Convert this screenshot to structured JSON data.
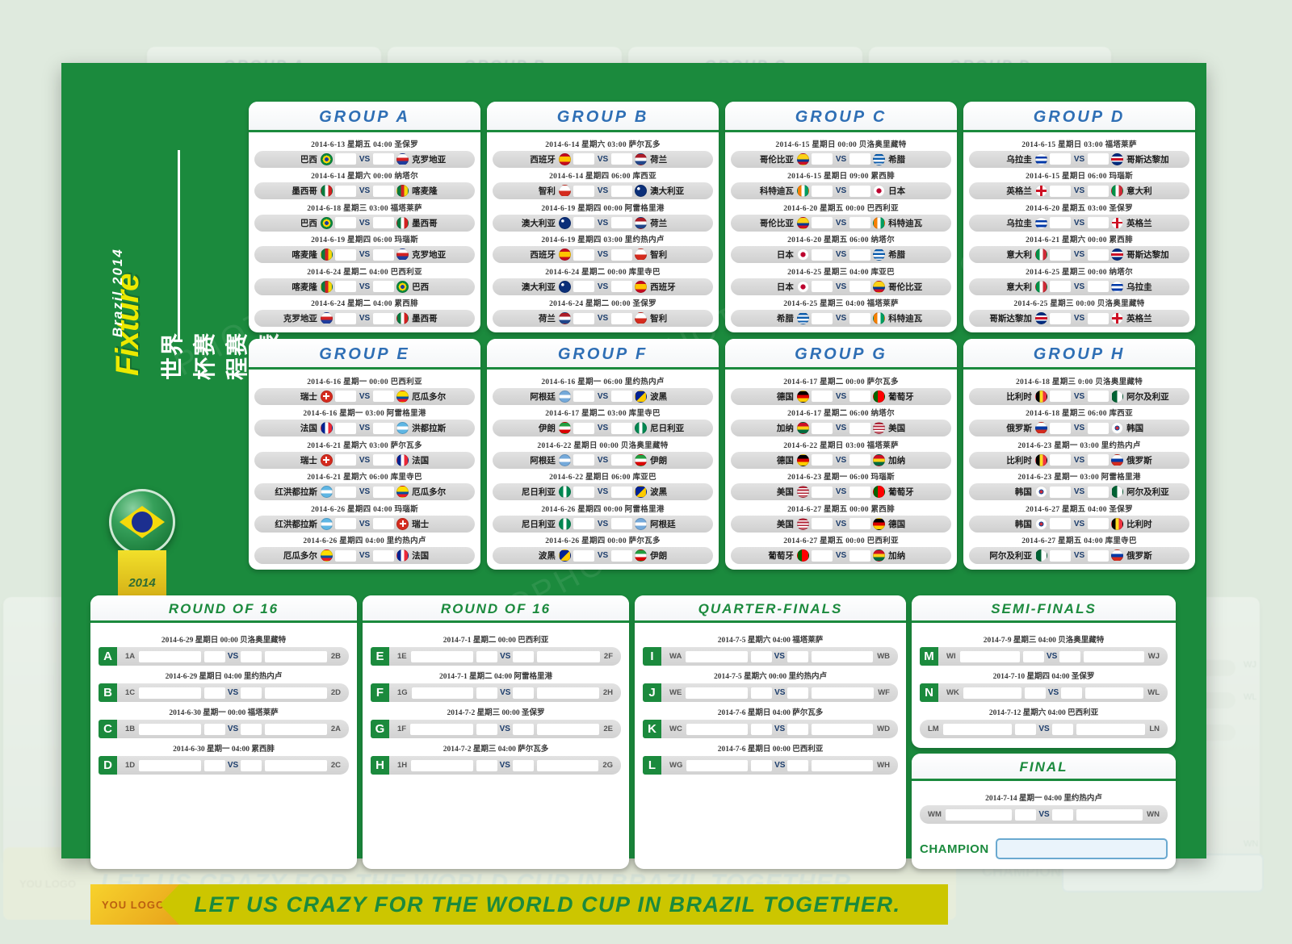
{
  "meta": {
    "title_main": "Fixture",
    "title_cn": "世界杯赛程赛果表",
    "title_sub": "Brazil 2014",
    "badge_year": "2014"
  },
  "banner": {
    "logo": "YOU LOGO",
    "text": "LET US CRAZY FOR THE WORLD CUP IN BRAZIL TOGETHER."
  },
  "vs_label": "VS",
  "groups": [
    {
      "name": "GROUP A",
      "matches": [
        {
          "date": "2014-6-13 星期五 04:00  圣保罗",
          "home": "巴西",
          "away": "克罗地亚",
          "home_flag": "br",
          "away_flag": "hr"
        },
        {
          "date": "2014-6-14 星期六 00:00  纳塔尔",
          "home": "墨西哥",
          "away": "喀麦隆",
          "home_flag": "mx",
          "away_flag": "cm"
        },
        {
          "date": "2014-6-18 星期三 03:00  福塔莱萨",
          "home": "巴西",
          "away": "墨西哥",
          "home_flag": "br",
          "away_flag": "mx"
        },
        {
          "date": "2014-6-19 星期四 06:00  玛瑙斯",
          "home": "喀麦隆",
          "away": "克罗地亚",
          "home_flag": "cm",
          "away_flag": "hr"
        },
        {
          "date": "2014-6-24 星期二 04:00  巴西利亚",
          "home": "喀麦隆",
          "away": "巴西",
          "home_flag": "cm",
          "away_flag": "br"
        },
        {
          "date": "2014-6-24 星期二 04:00  累西腓",
          "home": "克罗地亚",
          "away": "墨西哥",
          "home_flag": "hr",
          "away_flag": "mx"
        }
      ]
    },
    {
      "name": "GROUP B",
      "matches": [
        {
          "date": "2014-6-14 星期六 03:00  萨尔瓦多",
          "home": "西班牙",
          "away": "荷兰",
          "home_flag": "es",
          "away_flag": "nl"
        },
        {
          "date": "2014-6-14 星期四 06:00  库西亚",
          "home": "智利",
          "away": "澳大利亚",
          "home_flag": "cl",
          "away_flag": "au"
        },
        {
          "date": "2014-6-19 星期四 00:00  阿雷格里港",
          "home": "澳大利亚",
          "away": "荷兰",
          "home_flag": "au",
          "away_flag": "nl"
        },
        {
          "date": "2014-6-19 星期四 03:00  里约热内卢",
          "home": "西班牙",
          "away": "智利",
          "home_flag": "es",
          "away_flag": "cl"
        },
        {
          "date": "2014-6-24 星期二 00:00  库里寺巴",
          "home": "澳大利亚",
          "away": "西班牙",
          "home_flag": "au",
          "away_flag": "es"
        },
        {
          "date": "2014-6-24 星期二 00:00  圣保罗",
          "home": "荷兰",
          "away": "智利",
          "home_flag": "nl",
          "away_flag": "cl"
        }
      ]
    },
    {
      "name": "GROUP C",
      "matches": [
        {
          "date": "2014-6-15 星期日 00:00  贝洛奥里藏特",
          "home": "哥伦比亚",
          "away": "希腊",
          "home_flag": "co",
          "away_flag": "gr"
        },
        {
          "date": "2014-6-15 星期日 09:00  累西腓",
          "home": "科特迪瓦",
          "away": "日本",
          "home_flag": "ci",
          "away_flag": "jp"
        },
        {
          "date": "2014-6-20 星期五 00:00  巴西利亚",
          "home": "哥伦比亚",
          "away": "科特迪瓦",
          "home_flag": "co",
          "away_flag": "ci"
        },
        {
          "date": "2014-6-20 星期五 06:00  纳塔尔",
          "home": "日本",
          "away": "希腊",
          "home_flag": "jp",
          "away_flag": "gr"
        },
        {
          "date": "2014-6-25 星期三 04:00  库亚巴",
          "home": "日本",
          "away": "哥伦比亚",
          "home_flag": "jp",
          "away_flag": "co"
        },
        {
          "date": "2014-6-25 星期三 04:00  福塔莱萨",
          "home": "希腊",
          "away": "科特迪瓦",
          "home_flag": "gr",
          "away_flag": "ci"
        }
      ]
    },
    {
      "name": "GROUP D",
      "matches": [
        {
          "date": "2014-6-15 星期日 03:00  福塔莱萨",
          "home": "乌拉圭",
          "away": "哥斯达黎加",
          "home_flag": "uy",
          "away_flag": "cr"
        },
        {
          "date": "2014-6-15 星期日 06:00  玛瑙斯",
          "home": "英格兰",
          "away": "意大利",
          "home_flag": "en",
          "away_flag": "it"
        },
        {
          "date": "2014-6-20 星期五 03:00  圣保罗",
          "home": "乌拉圭",
          "away": "英格兰",
          "home_flag": "uy",
          "away_flag": "en"
        },
        {
          "date": "2014-6-21 星期六 00:00  累西腓",
          "home": "意大利",
          "away": "哥斯达黎加",
          "home_flag": "it",
          "away_flag": "cr"
        },
        {
          "date": "2014-6-25 星期三 00:00  纳塔尔",
          "home": "意大利",
          "away": "乌拉圭",
          "home_flag": "it",
          "away_flag": "uy"
        },
        {
          "date": "2014-6-25 星期三 00:00  贝洛奥里藏特",
          "home": "哥斯达黎加",
          "away": "英格兰",
          "home_flag": "cr",
          "away_flag": "en"
        }
      ]
    },
    {
      "name": "GROUP E",
      "matches": [
        {
          "date": "2014-6-16 星期一 00:00  巴西利亚",
          "home": "瑞士",
          "away": "厄瓜多尔",
          "home_flag": "ch",
          "away_flag": "ec"
        },
        {
          "date": "2014-6-16 星期一 03:00  阿雷格里港",
          "home": "法国",
          "away": "洪都拉斯",
          "home_flag": "fr",
          "away_flag": "hn"
        },
        {
          "date": "2014-6-21 星期六 03:00  萨尔瓦多",
          "home": "瑞士",
          "away": "法国",
          "home_flag": "ch",
          "away_flag": "fr"
        },
        {
          "date": "2014-6-21 星期六 06:00  库里寺巴",
          "home": "红洪都拉斯",
          "away": "厄瓜多尔",
          "home_flag": "hn",
          "away_flag": "ec"
        },
        {
          "date": "2014-6-26 星期四 04:00  玛瑙斯",
          "home": "红洪都拉斯",
          "away": "瑞士",
          "home_flag": "hn",
          "away_flag": "ch"
        },
        {
          "date": "2014-6-26 星期四 04:00  里约热内卢",
          "home": "厄瓜多尔",
          "away": "法国",
          "home_flag": "ec",
          "away_flag": "fr"
        }
      ]
    },
    {
      "name": "GROUP F",
      "matches": [
        {
          "date": "2014-6-16 星期一 06:00  里约热内卢",
          "home": "阿根廷",
          "away": "波黑",
          "home_flag": "ar",
          "away_flag": "ba"
        },
        {
          "date": "2014-6-17 星期二 03:00  库里寺巴",
          "home": "伊朗",
          "away": "尼日利亚",
          "home_flag": "ir",
          "away_flag": "ng"
        },
        {
          "date": "2014-6-22 星期日 00:00  贝洛奥里藏特",
          "home": "阿根廷",
          "away": "伊朗",
          "home_flag": "ar",
          "away_flag": "ir"
        },
        {
          "date": "2014-6-22 星期日 06:00  库亚巴",
          "home": "尼日利亚",
          "away": "波黑",
          "home_flag": "ng",
          "away_flag": "ba"
        },
        {
          "date": "2014-6-26 星期四 00:00  阿雷格里港",
          "home": "尼日利亚",
          "away": "阿根廷",
          "home_flag": "ng",
          "away_flag": "ar"
        },
        {
          "date": "2014-6-26 星期四 00:00  萨尔瓦多",
          "home": "波黑",
          "away": "伊朗",
          "home_flag": "ba",
          "away_flag": "ir"
        }
      ]
    },
    {
      "name": "GROUP G",
      "matches": [
        {
          "date": "2014-6-17 星期二 00:00  萨尔瓦多",
          "home": "德国",
          "away": "葡萄牙",
          "home_flag": "de",
          "away_flag": "pt"
        },
        {
          "date": "2014-6-17 星期二 06:00  纳塔尔",
          "home": "加纳",
          "away": "美国",
          "home_flag": "gh",
          "away_flag": "us"
        },
        {
          "date": "2014-6-22 星期日 03:00  福塔莱萨",
          "home": "德国",
          "away": "加纳",
          "home_flag": "de",
          "away_flag": "gh"
        },
        {
          "date": "2014-6-23 星期一 06:00  玛瑙斯",
          "home": "美国",
          "away": "葡萄牙",
          "home_flag": "us",
          "away_flag": "pt"
        },
        {
          "date": "2014-6-27 星期五 00:00  累西腓",
          "home": "美国",
          "away": "德国",
          "home_flag": "us",
          "away_flag": "de"
        },
        {
          "date": "2014-6-27 星期五 00:00  巴西利亚",
          "home": "葡萄牙",
          "away": "加纳",
          "home_flag": "pt",
          "away_flag": "gh"
        }
      ]
    },
    {
      "name": "GROUP H",
      "matches": [
        {
          "date": "2014-6-18 星期三 0:00  贝洛奥里藏特",
          "home": "比利时",
          "away": "阿尔及利亚",
          "home_flag": "be",
          "away_flag": "dz"
        },
        {
          "date": "2014-6-18 星期三 06:00  库西亚",
          "home": "俄罗斯",
          "away": "韩国",
          "home_flag": "ru",
          "away_flag": "kr"
        },
        {
          "date": "2014-6-23 星期一 03:00  里约热内卢",
          "home": "比利时",
          "away": "俄罗斯",
          "home_flag": "be",
          "away_flag": "ru"
        },
        {
          "date": "2014-6-23 星期一 03:00  阿雷格里港",
          "home": "韩国",
          "away": "阿尔及利亚",
          "home_flag": "kr",
          "away_flag": "dz"
        },
        {
          "date": "2014-6-27 星期五 04:00  圣保罗",
          "home": "韩国",
          "away": "比利时",
          "home_flag": "kr",
          "away_flag": "be"
        },
        {
          "date": "2014-6-27 星期五 04:00  库里寺巴",
          "home": "阿尔及利亚",
          "away": "俄罗斯",
          "home_flag": "dz",
          "away_flag": "ru"
        }
      ]
    }
  ],
  "knockout": [
    {
      "name": "ROUND OF 16",
      "matches": [
        {
          "letter": "A",
          "date": "2014-6-29 星期日 00:00  贝洛奥里藏特",
          "left_code": "1A",
          "right_code": "2B"
        },
        {
          "letter": "B",
          "date": "2014-6-29 星期日 04:00  里约热内卢",
          "left_code": "1C",
          "right_code": "2D"
        },
        {
          "letter": "C",
          "date": "2014-6-30 星期一 00:00  福塔莱萨",
          "left_code": "1B",
          "right_code": "2A"
        },
        {
          "letter": "D",
          "date": "2014-6-30 星期一 04:00  累西腓",
          "left_code": "1D",
          "right_code": "2C"
        }
      ]
    },
    {
      "name": "ROUND OF 16",
      "matches": [
        {
          "letter": "E",
          "date": "2014-7-1 星期二 00:00  巴西利亚",
          "left_code": "1E",
          "right_code": "2F"
        },
        {
          "letter": "F",
          "date": "2014-7-1 星期二 04:00  阿雷格里港",
          "left_code": "1G",
          "right_code": "2H"
        },
        {
          "letter": "G",
          "date": "2014-7-2 星期三 00:00  圣保罗",
          "left_code": "1F",
          "right_code": "2E"
        },
        {
          "letter": "H",
          "date": "2014-7-2 星期三 04:00  萨尔瓦多",
          "left_code": "1H",
          "right_code": "2G"
        }
      ]
    },
    {
      "name": "QUARTER-FINALS",
      "matches": [
        {
          "letter": "I",
          "date": "2014-7-5 星期六 04:00  福塔莱萨",
          "left_code": "WA",
          "right_code": "WB"
        },
        {
          "letter": "J",
          "date": "2014-7-5 星期六 00:00  里约热内卢",
          "left_code": "WE",
          "right_code": "WF"
        },
        {
          "letter": "K",
          "date": "2014-7-6 星期日 04:00  萨尔瓦多",
          "left_code": "WC",
          "right_code": "WD"
        },
        {
          "letter": "L",
          "date": "2014-7-6 星期日 00:00  巴西利亚",
          "left_code": "WG",
          "right_code": "WH"
        }
      ]
    }
  ],
  "semifinals": {
    "name": "SEMI-FINALS",
    "matches": [
      {
        "letter": "M",
        "date": "2014-7-9 星期三 04:00  贝洛奥里藏特",
        "left_code": "WI",
        "right_code": "WJ"
      },
      {
        "letter": "N",
        "date": "2014-7-10 星期四 04:00  圣保罗",
        "left_code": "WK",
        "right_code": "WL"
      },
      {
        "letter": "",
        "date": "2014-7-12 星期六 04:00  巴西利亚",
        "left_code": "LM",
        "right_code": "LN"
      }
    ]
  },
  "final": {
    "name": "FINAL",
    "match": {
      "letter": "",
      "date": "2014-7-14 星期一 04:00  里约热内卢",
      "left_code": "WM",
      "right_code": "WN"
    },
    "champion_label": "CHAMPION"
  },
  "colors": {
    "board_green": "#1b8a3d",
    "group_title_blue": "#2f6fb5",
    "ko_title_green": "#1b8a3d",
    "banner_yellow": "#ccc600",
    "title_yellow": "#ece900"
  },
  "watermark": "PHOTOPHOTO.CN"
}
